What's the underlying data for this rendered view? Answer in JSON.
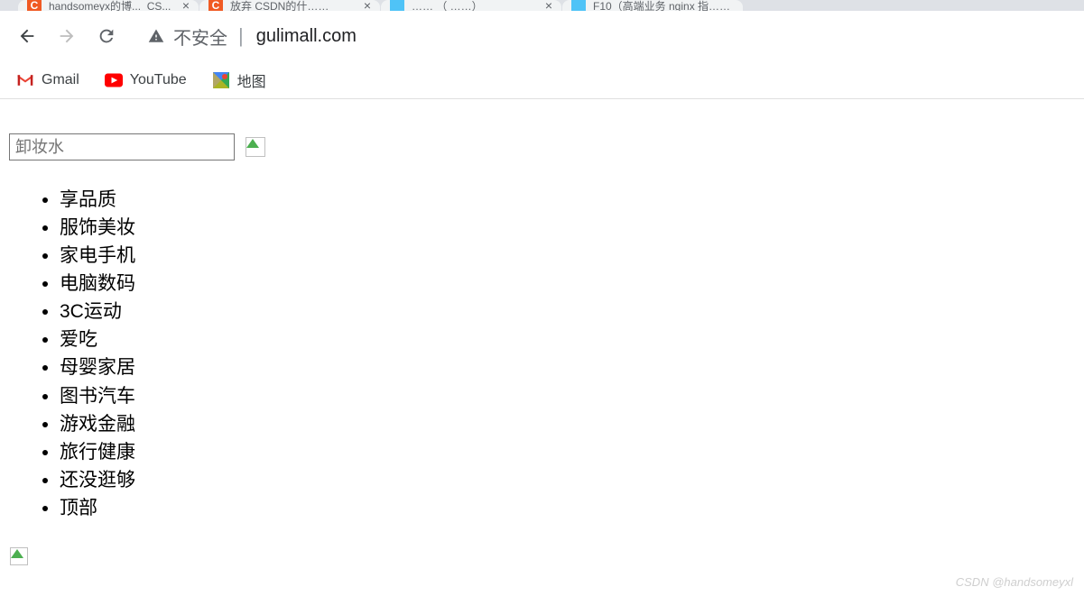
{
  "tabs": [
    {
      "title": "handsomeyx的博..._CS...",
      "favicon_type": "csdn"
    },
    {
      "title": "放弃  CSDN的什……",
      "favicon_type": "csdn"
    },
    {
      "title": "…… （ ……）",
      "favicon_type": "alt"
    },
    {
      "title": "F10（高端业务  nginx  指……",
      "favicon_type": "alt"
    }
  ],
  "address": {
    "security_label": "不安全",
    "url": "gulimall.com"
  },
  "bookmarks": {
    "gmail": "Gmail",
    "youtube": "YouTube",
    "maps": "地图"
  },
  "search": {
    "placeholder": "卸妆水"
  },
  "categories": [
    "享品质",
    "服饰美妆",
    "家电手机",
    "电脑数码",
    "3C运动",
    "爱吃",
    "母婴家居",
    "图书汽车",
    "游戏金融",
    "旅行健康",
    "还没逛够",
    "顶部"
  ],
  "watermark": "CSDN @handsomeyxl"
}
